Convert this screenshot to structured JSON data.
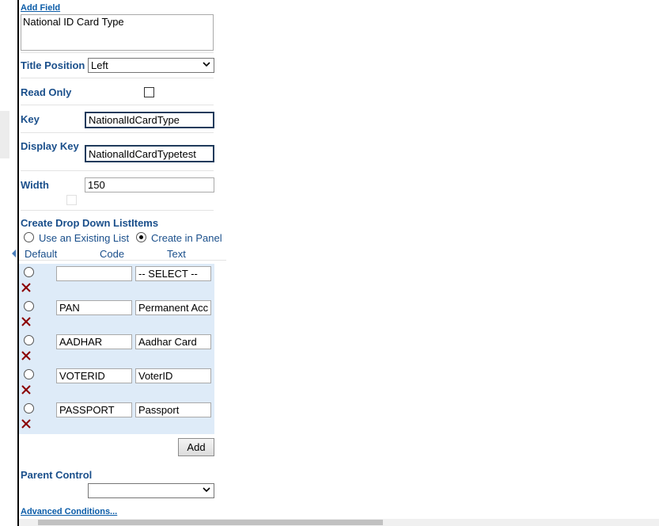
{
  "panel": {
    "add_field_link": "Add Field",
    "field_name_value": "National ID Card Type",
    "title_position": {
      "label": "Title Position",
      "selected": "Left"
    },
    "read_only": {
      "label": "Read Only",
      "checked": false
    },
    "key": {
      "label": "Key",
      "value": "NationalIdCardType"
    },
    "display_key": {
      "label": "Display Key",
      "value": "NationalIdCardTypetest"
    },
    "width": {
      "label": "Width",
      "value": "150"
    },
    "dropdown": {
      "heading": "Create Drop Down ListItems",
      "option_existing": "Use an Existing List",
      "option_panel": "Create in Panel",
      "selected_option": "Create in Panel",
      "col_default": "Default",
      "col_code": "Code",
      "col_text": "Text",
      "rows": [
        {
          "code": "",
          "text": "-- SELECT --"
        },
        {
          "code": "PAN",
          "text": "Permanent Acco"
        },
        {
          "code": "AADHAR",
          "text": "Aadhar Card"
        },
        {
          "code": "VOTERID",
          "text": "VoterID"
        },
        {
          "code": "PASSPORT",
          "text": "Passport"
        }
      ],
      "add_button": "Add"
    },
    "parent_control": {
      "label": "Parent Control",
      "selected": ""
    },
    "advanced_link": "Advanced Conditions..."
  },
  "icons": {
    "delete": "delete-x-icon",
    "chevron": "chevron-down-icon",
    "collapse": "collapse-left-arrow-icon"
  },
  "colors": {
    "label_blue": "#1a4f8b",
    "link_blue": "#0b5ca8",
    "row_bg": "#deebf8",
    "delete_red": "#8b0000"
  }
}
